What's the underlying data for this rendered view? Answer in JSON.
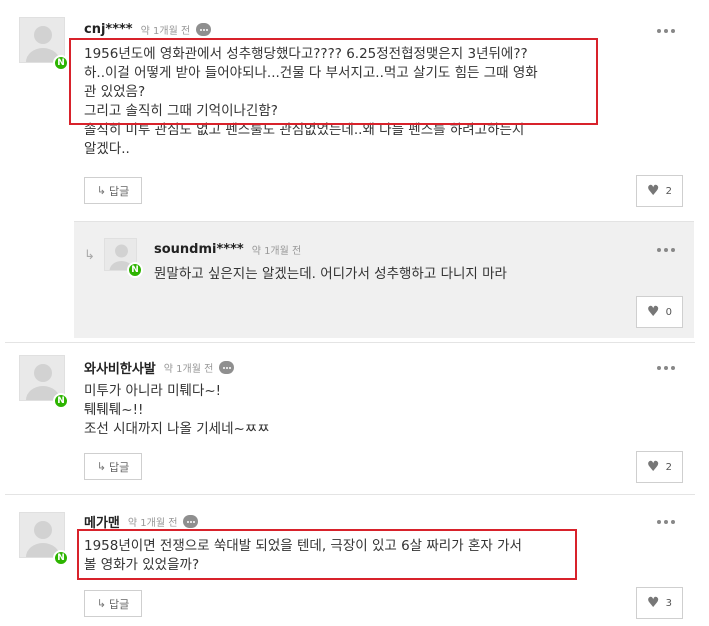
{
  "comments": [
    {
      "author": "cnj****",
      "time": "약 1개월 전",
      "lines": [
        "1956년도에 영화관에서 성추행당했다고???? 6.25정전협정맺은지 3년뒤에??",
        "하..이걸 어떻게 받아 들어야되나...건물 다 부서지고..먹고 살기도 힘든 그때 영화",
        "관 있었음?",
        "그리고 솔직히 그때 기억이나긴함?",
        "솔직히 미투 관심도 없고 펜스룰도 관심없었는데..왜 다들 펜스를 하려고하는지",
        "알겠다.."
      ],
      "reply_label": "답글",
      "likes": "2"
    },
    {
      "author": "soundmi****",
      "time": "약 1개월 전",
      "lines": [
        "뭔말하고 싶은지는 알겠는데. 어디가서 성추행하고 다니지 마라"
      ],
      "likes": "0"
    },
    {
      "author": "와사비한사발",
      "time": "약 1개월 전",
      "lines": [
        "미투가 아니라 미퉤다~!",
        "퉤퉤퉤~!!",
        "조선 시대까지 나올 기세네~ㅉㅉ"
      ],
      "reply_label": "답글",
      "likes": "2"
    },
    {
      "author": "메가맨",
      "time": "약 1개월 전",
      "lines": [
        "1958년이면 전쟁으로 쑥대발 되었을 텐데, 극장이 있고 6살 짜리가 혼자 가서",
        "볼 영화가 있었을까?"
      ],
      "reply_label": "답글",
      "likes": "3"
    }
  ],
  "badge_letter": "N",
  "colors": {
    "highlight": "#d8222b",
    "naver_green": "#2db400",
    "reply_bg": "#f0f0f0"
  }
}
